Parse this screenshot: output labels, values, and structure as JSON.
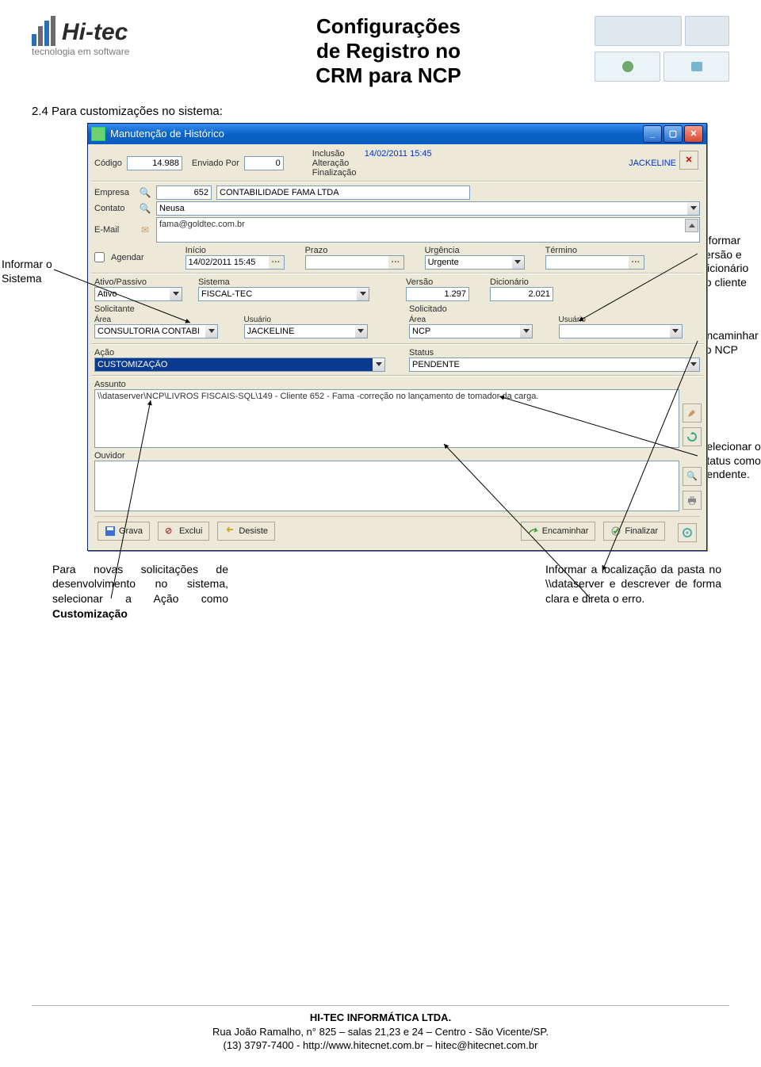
{
  "header": {
    "logo_brand": "Hi-tec",
    "logo_tagline": "tecnologia em software",
    "title_line1": "Configurações",
    "title_line2": "de Registro no",
    "title_line3": "CRM para NCP"
  },
  "section": {
    "heading": "2.4 Para customizações no sistema:"
  },
  "callouts": {
    "left1": "Informar o Sistema",
    "right1": "Informar versão e Dicionário do cliente",
    "right2": "Encaminhar ao NCP",
    "right3": "Selecionar o Status como Pendente.",
    "bottom_left": "Para novas solicitações de desenvolvimento no sistema, selecionar a Ação como ",
    "bottom_left_bold": "Customização",
    "bottom_right": "Informar a localização da pasta no \\\\dataserver e descrever de forma clara e direta o erro."
  },
  "window": {
    "title": "Manutenção de Histórico",
    "labels": {
      "codigo": "Código",
      "enviado_por": "Enviado Por",
      "inclusao": "Inclusão",
      "alteracao": "Alteração",
      "finalizacao": "Finalização",
      "empresa": "Empresa",
      "contato": "Contato",
      "email": "E-Mail",
      "agendar": "Agendar",
      "inicio": "Início",
      "prazo": "Prazo",
      "urgencia": "Urgência",
      "termino": "Término",
      "ativo_passivo": "Ativo/Passivo",
      "sistema": "Sistema",
      "versao": "Versão",
      "dicionario": "Dicionário",
      "solicitante": "Solicitante",
      "solicitado": "Solicitado",
      "area": "Área",
      "usuario": "Usuário",
      "acao": "Ação",
      "status": "Status",
      "assunto": "Assunto",
      "ouvidor": "Ouvidor"
    },
    "values": {
      "codigo": "14.988",
      "enviado_por": "0",
      "inclusao": "14/02/2011 15:45",
      "user_top": "JACKELINE",
      "empresa_id": "652",
      "empresa_nome": "CONTABILIDADE FAMA LTDA",
      "contato": "Neusa",
      "email": "fama@goldtec.com.br",
      "inicio": "14/02/2011 15:45",
      "urgencia": "Urgente",
      "ativo_passivo": "Ativo",
      "sistema": "FISCAL-TEC",
      "versao": "1.297",
      "dicionario": "2.021",
      "solicitante_area": "CONSULTORIA CONTABI",
      "solicitante_usuario": "JACKELINE",
      "solicitado_area": "NCP",
      "solicitado_usuario": "",
      "acao": "CUSTOMIZAÇÃO",
      "status": "PENDENTE",
      "assunto": "\\\\dataserver\\NCP\\LIVROS FISCAIS-SQL\\149 - Cliente 652 - Fama  -correção no lançamento de tomador da carga."
    },
    "buttons": {
      "grava": "Grava",
      "exclui": "Exclui",
      "desiste": "Desiste",
      "encaminhar": "Encaminhar",
      "finalizar": "Finalizar"
    }
  },
  "footer": {
    "company": "HI-TEC INFORMÁTICA LTDA.",
    "address": "Rua João Ramalho, n° 825 – salas 21,23 e 24 – Centro - São Vicente/SP.",
    "contact": "(13) 3797-7400 - http://www.hitecnet.com.br – hitec@hitecnet.com.br"
  }
}
